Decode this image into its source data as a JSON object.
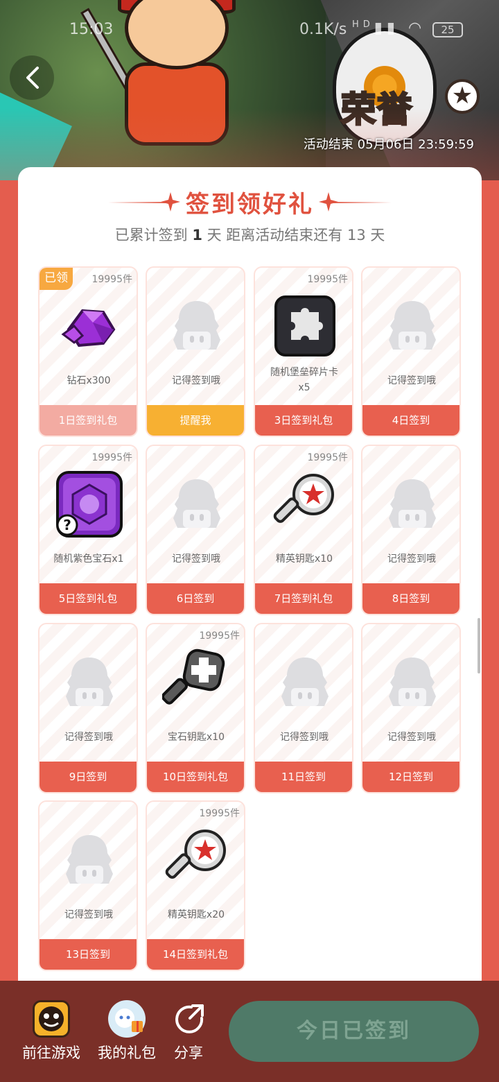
{
  "status_bar": {
    "time": "15:03",
    "network_speed": "0.1K/s",
    "signal_label": "HD",
    "battery": "25"
  },
  "banner": {
    "logo_text": "荣誉",
    "end_time": "活动结束 05月06日 23:59:59"
  },
  "header": {
    "title": "签到领好礼",
    "subtitle_prefix": "已累计签到",
    "signed_days": "1",
    "subtitle_mid": "天  距离活动结束还有 13 天"
  },
  "tiles": [
    {
      "count": "19995件",
      "badge": "已领",
      "icon": "diamond-gem-icon",
      "label": "钻石x300",
      "button": "1日签到礼包",
      "state": "claimed"
    },
    {
      "count": "",
      "badge": "",
      "icon": "placeholder-ghost-icon",
      "label": "记得签到哦",
      "button": "提醒我",
      "state": "remind"
    },
    {
      "count": "19995件",
      "badge": "",
      "icon": "puzzle-piece-card-icon",
      "label": "随机堡垒碎片卡x5",
      "button": "3日签到礼包",
      "state": "normal"
    },
    {
      "count": "",
      "badge": "",
      "icon": "placeholder-ghost-icon",
      "label": "记得签到哦",
      "button": "4日签到",
      "state": "normal"
    },
    {
      "count": "19995件",
      "badge": "",
      "icon": "purple-gem-card-icon",
      "label": "随机紫色宝石x1",
      "button": "5日签到礼包",
      "state": "normal"
    },
    {
      "count": "",
      "badge": "",
      "icon": "placeholder-ghost-icon",
      "label": "记得签到哦",
      "button": "6日签到",
      "state": "normal"
    },
    {
      "count": "19995件",
      "badge": "",
      "icon": "elite-key-icon",
      "label": "精英钥匙x10",
      "button": "7日签到礼包",
      "state": "normal"
    },
    {
      "count": "",
      "badge": "",
      "icon": "placeholder-ghost-icon",
      "label": "记得签到哦",
      "button": "8日签到",
      "state": "normal"
    },
    {
      "count": "",
      "badge": "",
      "icon": "placeholder-ghost-icon",
      "label": "记得签到哦",
      "button": "9日签到",
      "state": "normal"
    },
    {
      "count": "19995件",
      "badge": "",
      "icon": "gem-key-icon",
      "label": "宝石钥匙x10",
      "button": "10日签到礼包",
      "state": "normal"
    },
    {
      "count": "",
      "badge": "",
      "icon": "placeholder-ghost-icon",
      "label": "记得签到哦",
      "button": "11日签到",
      "state": "normal"
    },
    {
      "count": "",
      "badge": "",
      "icon": "placeholder-ghost-icon",
      "label": "记得签到哦",
      "button": "12日签到",
      "state": "normal"
    },
    {
      "count": "",
      "badge": "",
      "icon": "placeholder-ghost-icon",
      "label": "记得签到哦",
      "button": "13日签到",
      "state": "normal"
    },
    {
      "count": "19995件",
      "badge": "",
      "icon": "elite-key-icon",
      "label": "精英钥匙x20",
      "button": "14日签到礼包",
      "state": "normal"
    }
  ],
  "bottom_bar": {
    "go_game": "前往游戏",
    "my_gifts": "我的礼包",
    "share": "分享",
    "signed_button": "今日已签到"
  },
  "colors": {
    "accent": "#e0523f",
    "button": "#e8604f",
    "claimed": "#f3aba2",
    "remind": "#f7b032",
    "bottom_bar": "#7a2f28",
    "signed_button": "#4f7a68"
  }
}
